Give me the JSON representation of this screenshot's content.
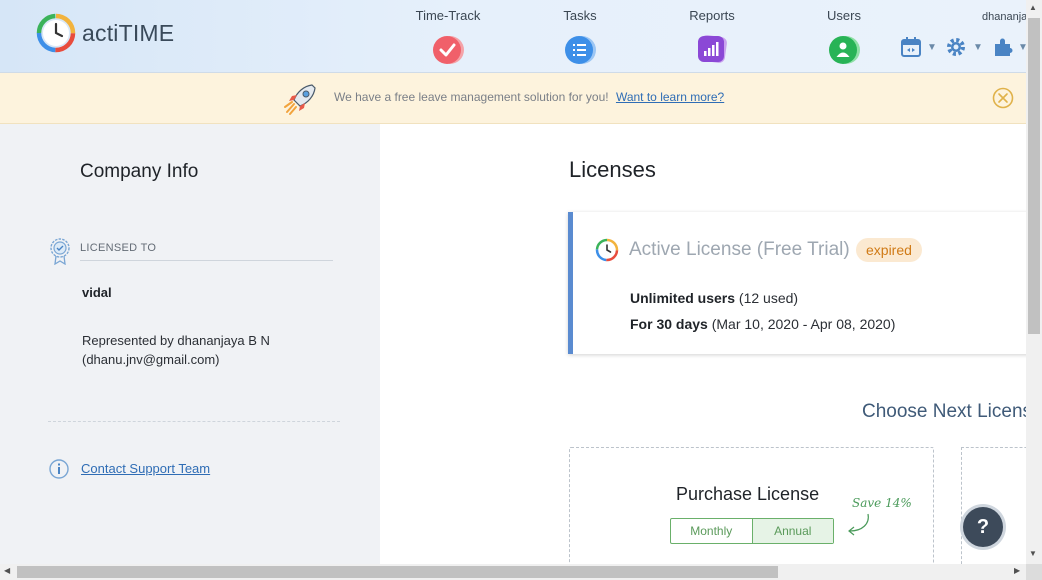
{
  "app": {
    "name": "actiTIME"
  },
  "nav": {
    "items": [
      {
        "label": "Time-Track",
        "icon": "time-track-icon",
        "color": "#f0606a"
      },
      {
        "label": "Tasks",
        "icon": "tasks-icon",
        "color": "#3d8fe8"
      },
      {
        "label": "Reports",
        "icon": "reports-icon",
        "color": "#8b48d6"
      },
      {
        "label": "Users",
        "icon": "users-icon",
        "color": "#28b356"
      }
    ],
    "user_name": "dhananjaya"
  },
  "banner": {
    "text": "We have a free leave management solution for you!",
    "link": "Want to learn more?"
  },
  "sidebar": {
    "title": "Company Info",
    "licensed_to_label": "LICENSED TO",
    "company_name": "vidal",
    "represented_line1": "Represented by dhananjaya B N",
    "represented_line2": "(dhanu.jnv@gmail.com)",
    "support_link": "Contact Support Team"
  },
  "main": {
    "title": "Licenses",
    "license_card": {
      "title": "Active License (Free Trial)",
      "status_badge": "expired",
      "users_bold": "Unlimited users",
      "users_detail": "(12 used)",
      "period_bold": "For 30 days",
      "period_detail": "(Mar 10, 2020 - Apr 08, 2020)"
    },
    "choose_title": "Choose Next License",
    "purchase": {
      "title": "Purchase License",
      "options": [
        "Monthly",
        "Annual"
      ],
      "selected": "Annual",
      "save_note": "Save 14%"
    },
    "help_label": "?"
  },
  "colors": {
    "accent": "#5a8bd0",
    "badge_text": "#d07a16",
    "link": "#2f6db5"
  }
}
